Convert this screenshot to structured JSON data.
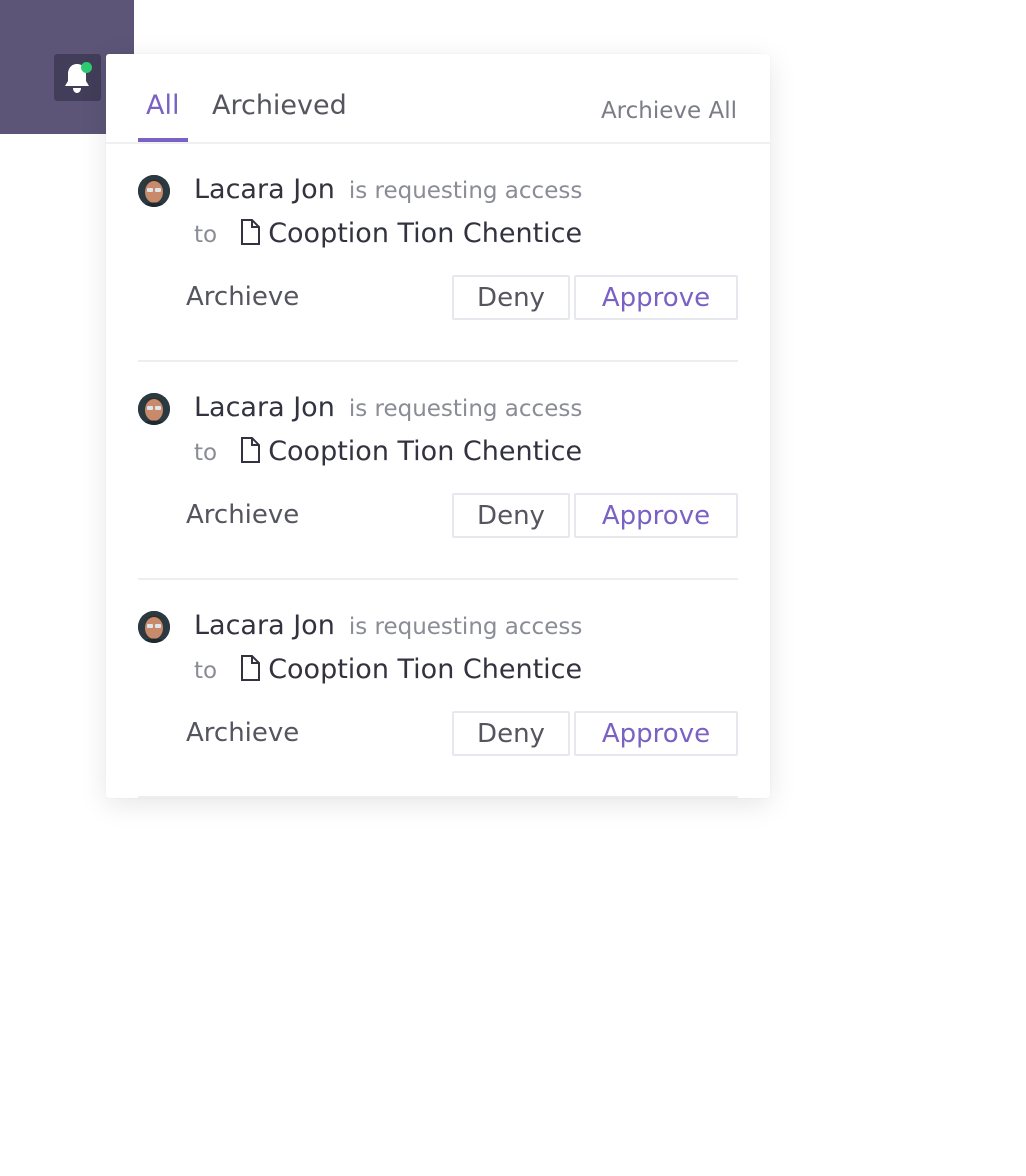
{
  "header": {
    "bell_icon": "bell-icon",
    "notification_dot_color": "#2ecc71",
    "bar_color": "#5c5577"
  },
  "panel": {
    "tabs": [
      {
        "label": "All",
        "active": true
      },
      {
        "label": "Archieved",
        "active": false
      }
    ],
    "archive_all_label": "Archieve All",
    "accent_color": "#7b61c4",
    "items": [
      {
        "name": "Lacara Jon",
        "action": "is requesting access",
        "to": "to",
        "target": "Cooption Tion Chentice",
        "archive_label": "Archieve",
        "deny_label": "Deny",
        "approve_label": "Approve"
      },
      {
        "name": "Lacara Jon",
        "action": "is requesting access",
        "to": "to",
        "target": "Cooption Tion Chentice",
        "archive_label": "Archieve",
        "deny_label": "Deny",
        "approve_label": "Approve"
      },
      {
        "name": "Lacara Jon",
        "action": "is requesting access",
        "to": "to",
        "target": "Cooption Tion Chentice",
        "archive_label": "Archieve",
        "deny_label": "Deny",
        "approve_label": "Approve"
      }
    ]
  }
}
